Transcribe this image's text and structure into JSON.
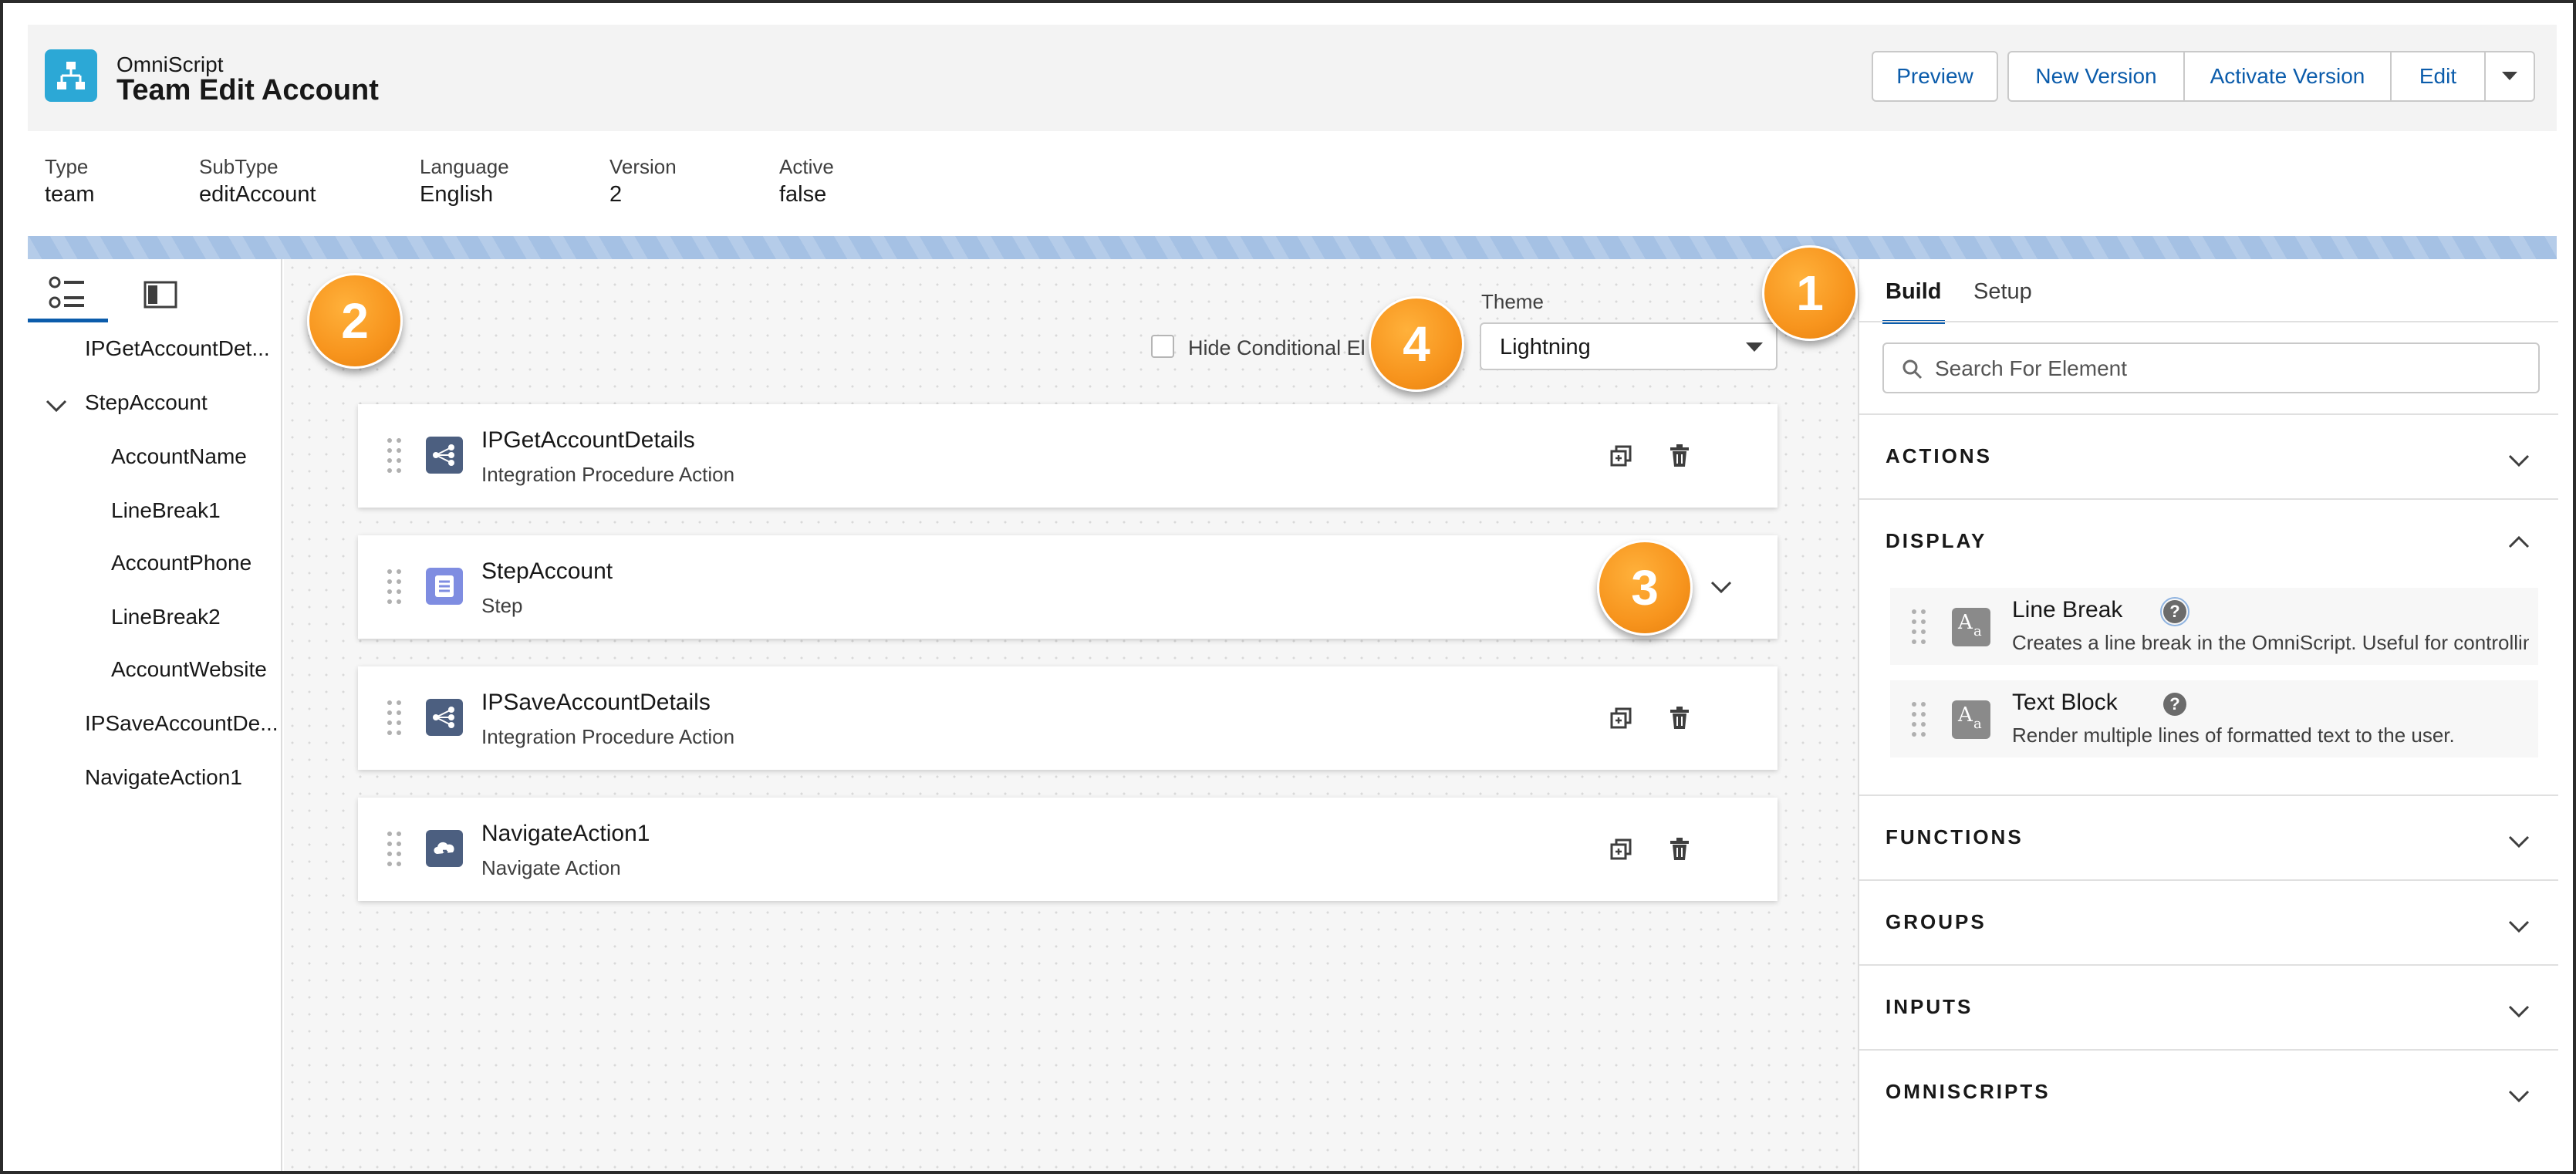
{
  "header": {
    "app_type": "OmniScript",
    "title": "Team Edit Account",
    "buttons": {
      "preview": "Preview",
      "new_version": "New Version",
      "activate_version": "Activate Version",
      "edit": "Edit"
    }
  },
  "meta": [
    {
      "label": "Type",
      "value": "team"
    },
    {
      "label": "SubType",
      "value": "editAccount"
    },
    {
      "label": "Language",
      "value": "English"
    },
    {
      "label": "Version",
      "value": "2"
    },
    {
      "label": "Active",
      "value": "false"
    }
  ],
  "tree": {
    "items": [
      "IPGetAccountDet...",
      "StepAccount",
      "AccountName",
      "LineBreak1",
      "AccountPhone",
      "LineBreak2",
      "AccountWebsite",
      "IPSaveAccountDe...",
      "NavigateAction1"
    ]
  },
  "canvas": {
    "hide_conditional_label": "Hide Conditional El",
    "theme_label": "Theme",
    "theme_value": "Lightning",
    "cards": [
      {
        "name": "IPGetAccountDetails",
        "type": "Integration Procedure Action"
      },
      {
        "name": "StepAccount",
        "type": "Step"
      },
      {
        "name": "IPSaveAccountDetails",
        "type": "Integration Procedure Action"
      },
      {
        "name": "NavigateAction1",
        "type": "Navigate Action"
      }
    ]
  },
  "callouts": [
    "1",
    "2",
    "3",
    "4"
  ],
  "right_panel": {
    "tabs": {
      "build": "Build",
      "setup": "Setup"
    },
    "search_placeholder": "Search For Element",
    "sections": {
      "actions": "ACTIONS",
      "display": "DISPLAY",
      "functions": "FUNCTIONS",
      "groups": "GROUPS",
      "inputs": "INPUTS",
      "omniscripts": "OMNISCRIPTS"
    },
    "display_items": [
      {
        "name": "Line Break",
        "desc": "Creates a line break in the OmniScript. Useful for controllin"
      },
      {
        "name": "Text Block",
        "desc": "Render multiple lines of formatted text to the user."
      }
    ]
  },
  "colors": {
    "brand_blue": "#0b5cab",
    "logo": "#2ca8d6",
    "callout_orange": "#f7941d",
    "ip_icon": "#4c5f80",
    "step_icon": "#7f8de1"
  }
}
